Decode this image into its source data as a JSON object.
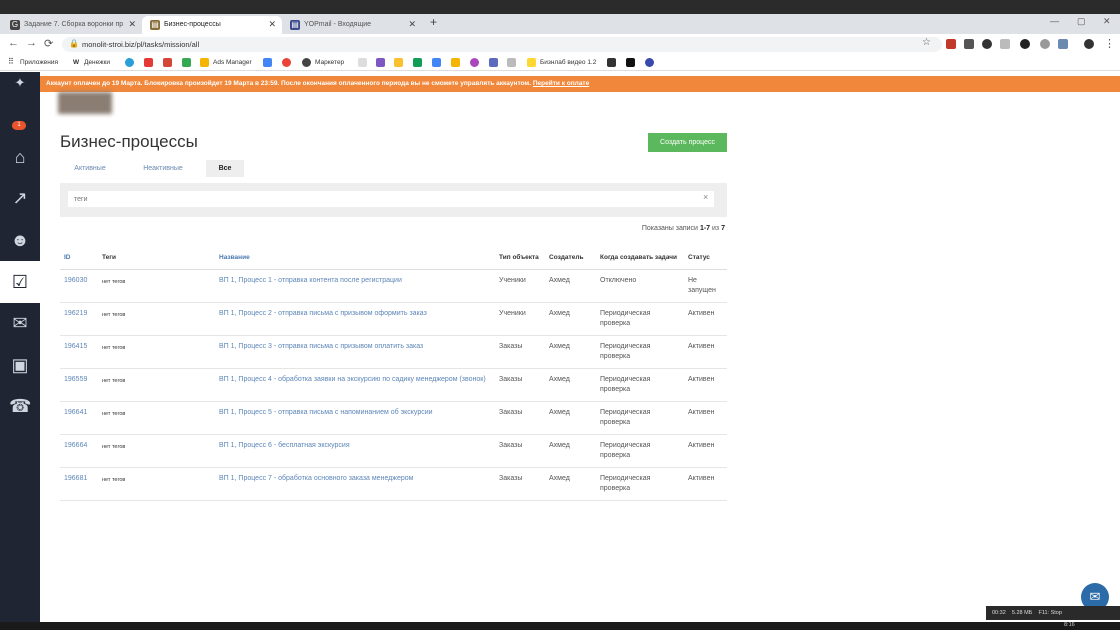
{
  "browser": {
    "tabs": [
      {
        "title": "Задание 7. Сборка воронки пр"
      },
      {
        "title": "Бизнес-процессы"
      },
      {
        "title": "YOPmail - Входящие"
      }
    ],
    "url": "monolit-stroi.biz/pl/tasks/mission/all",
    "bookmarks": [
      "Приложения",
      "Денежки",
      "Ads Manager",
      "Маркетер",
      "Бизнлаб видео 1.2"
    ],
    "icons": {
      "back": "←",
      "forward": "→",
      "reload": "⟳",
      "lock": "🔒",
      "star": "☆",
      "newtab": "+",
      "min": "—",
      "max": "▢",
      "close": "✕",
      "menu": "⋮",
      "apps": "⠿"
    }
  },
  "sidebar": {
    "badge": "1"
  },
  "banner": {
    "text": "Аккаунт оплачен до 19 Марта. Блокировка произойдет 19 Марта в 23:59. После окончания оплаченного периода вы не сможете управлять аккаунтом.",
    "link": "Перейти к оплате"
  },
  "page": {
    "title": "Бизнес-процессы",
    "create_button": "Создать процесс",
    "filters": [
      "Активные",
      "Неактивные",
      "Все"
    ],
    "search_placeholder": "теги",
    "search_clear": "×",
    "records_prefix": "Показаны записи",
    "records_range": "1-7",
    "records_of": "из",
    "records_total": "7"
  },
  "table": {
    "columns": [
      "ID",
      "Теги",
      "Название",
      "Тип объекта",
      "Создатель",
      "Когда создавать задачи",
      "Статус"
    ],
    "rows": [
      {
        "id": "196030",
        "tags": "нет тегов",
        "name": "ВП 1, Процесс 1 - отправка контента после регистрации",
        "type": "Ученики",
        "creator": "Ахмед",
        "when": "Отключено",
        "status": "Не запущен"
      },
      {
        "id": "196219",
        "tags": "нет тегов",
        "name": "ВП 1, Процесс 2 - отправка письма с призывом оформить заказ",
        "type": "Ученики",
        "creator": "Ахмед",
        "when": "Периодическая проверка",
        "status": "Активен"
      },
      {
        "id": "196415",
        "tags": "нет тегов",
        "name": "ВП 1, Процесс 3 - отправка письма с призывом оплатить заказ",
        "type": "Заказы",
        "creator": "Ахмед",
        "when": "Периодическая проверка",
        "status": "Активен"
      },
      {
        "id": "196559",
        "tags": "нет тегов",
        "name": "ВП 1, Процесс 4 - обработка заявки на экскурсию по садику менеджером (звонок)",
        "type": "Заказы",
        "creator": "Ахмед",
        "when": "Периодическая проверка",
        "status": "Активен"
      },
      {
        "id": "196641",
        "tags": "нет тегов",
        "name": "ВП 1, Процесс 5 - отправка письма с напоминанием об экскурсии",
        "type": "Заказы",
        "creator": "Ахмед",
        "when": "Периодическая проверка",
        "status": "Активен"
      },
      {
        "id": "196664",
        "tags": "нет тегов",
        "name": "ВП 1, Процесс 6 - бесплатная экскурсия",
        "type": "Заказы",
        "creator": "Ахмед",
        "when": "Периодическая проверка",
        "status": "Активен"
      },
      {
        "id": "196681",
        "tags": "нет тегов",
        "name": "ВП 1, Процесс 7 - обработка основного заказа менеджером",
        "type": "Заказы",
        "creator": "Ахмед",
        "when": "Периодическая проверка",
        "status": "Активен"
      }
    ]
  },
  "recorder": {
    "elapsed": "00:32",
    "size": "5.28 МБ",
    "stop": "F11: Stop"
  },
  "taskbar": {
    "time": "8:16"
  },
  "colors": {
    "sidebar": "#1f2532",
    "banner": "#f0873a",
    "create_button": "#5cb85c",
    "link": "#5d86b8"
  }
}
